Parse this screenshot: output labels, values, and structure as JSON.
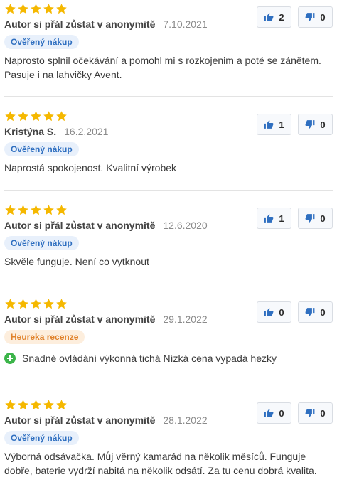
{
  "colors": {
    "star": "#f5b800",
    "thumb": "#2f6fc0",
    "verified_bg": "#e8f0fb",
    "heureka_bg": "#fdeedd",
    "pro": "#3cb54a"
  },
  "reviews": [
    {
      "stars": 5,
      "author": "Autor si přál zůstat v anonymitě",
      "date": "7.10.2021",
      "badge": "Ověřený nákup",
      "text": "Naprosto splnil očekávání a pomohl mi s rozkojenim a poté se zánětem. Pasuje i na lahvičky Avent.",
      "likes": "2",
      "dislikes": "0"
    },
    {
      "stars": 5,
      "author": "Kristýna S.",
      "date": "16.2.2021",
      "badge": "Ověřený nákup",
      "text": "Naprostá spokojenost. Kvalitní výrobek",
      "likes": "1",
      "dislikes": "0"
    },
    {
      "stars": 5,
      "author": "Autor si přál zůstat v anonymitě",
      "date": "12.6.2020",
      "badge": "Ověřený nákup",
      "text": "Skvěle funguje. Není co vytknout",
      "likes": "1",
      "dislikes": "0"
    },
    {
      "stars": 5,
      "author": "Autor si přál zůstat v anonymitě",
      "date": "29.1.2022",
      "badge": "Heureka recenze",
      "pro": "Snadné ovládání výkonná tichá Nízká cena vypadá hezky",
      "likes": "0",
      "dislikes": "0"
    },
    {
      "stars": 5,
      "author": "Autor si přál zůstat v anonymitě",
      "date": "28.1.2022",
      "badge": "Ověřený nákup",
      "text": "Výborná odsávačka. Můj věrný kamarád na několik měsíců. Funguje dobře, baterie vydrží nabitá na několik odsátí. Za tu cenu dobrá kvalita.",
      "likes": "0",
      "dislikes": "0"
    }
  ]
}
